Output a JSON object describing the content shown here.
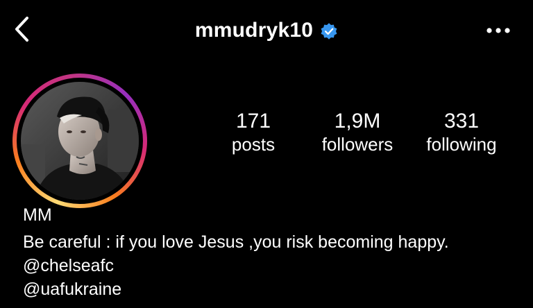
{
  "header": {
    "username": "mmudryk10",
    "back_icon": "chevron-left-icon",
    "verified_icon": "verified-badge-icon",
    "verified_color": "#3897f0",
    "more_icon": "more-horizontal-icon"
  },
  "profile": {
    "avatar_ring_colors": [
      "#feda75",
      "#fa7e1e",
      "#d62976",
      "#962fbf"
    ],
    "stats": [
      {
        "value": "171",
        "label": "posts"
      },
      {
        "value": "1,9M",
        "label": "followers"
      },
      {
        "value": "331",
        "label": "following"
      }
    ]
  },
  "bio": {
    "display_name": "MM",
    "text": "Be careful : if you love Jesus ,you risk becoming happy.",
    "links": [
      "@chelseafc",
      "@uafukraine"
    ]
  }
}
